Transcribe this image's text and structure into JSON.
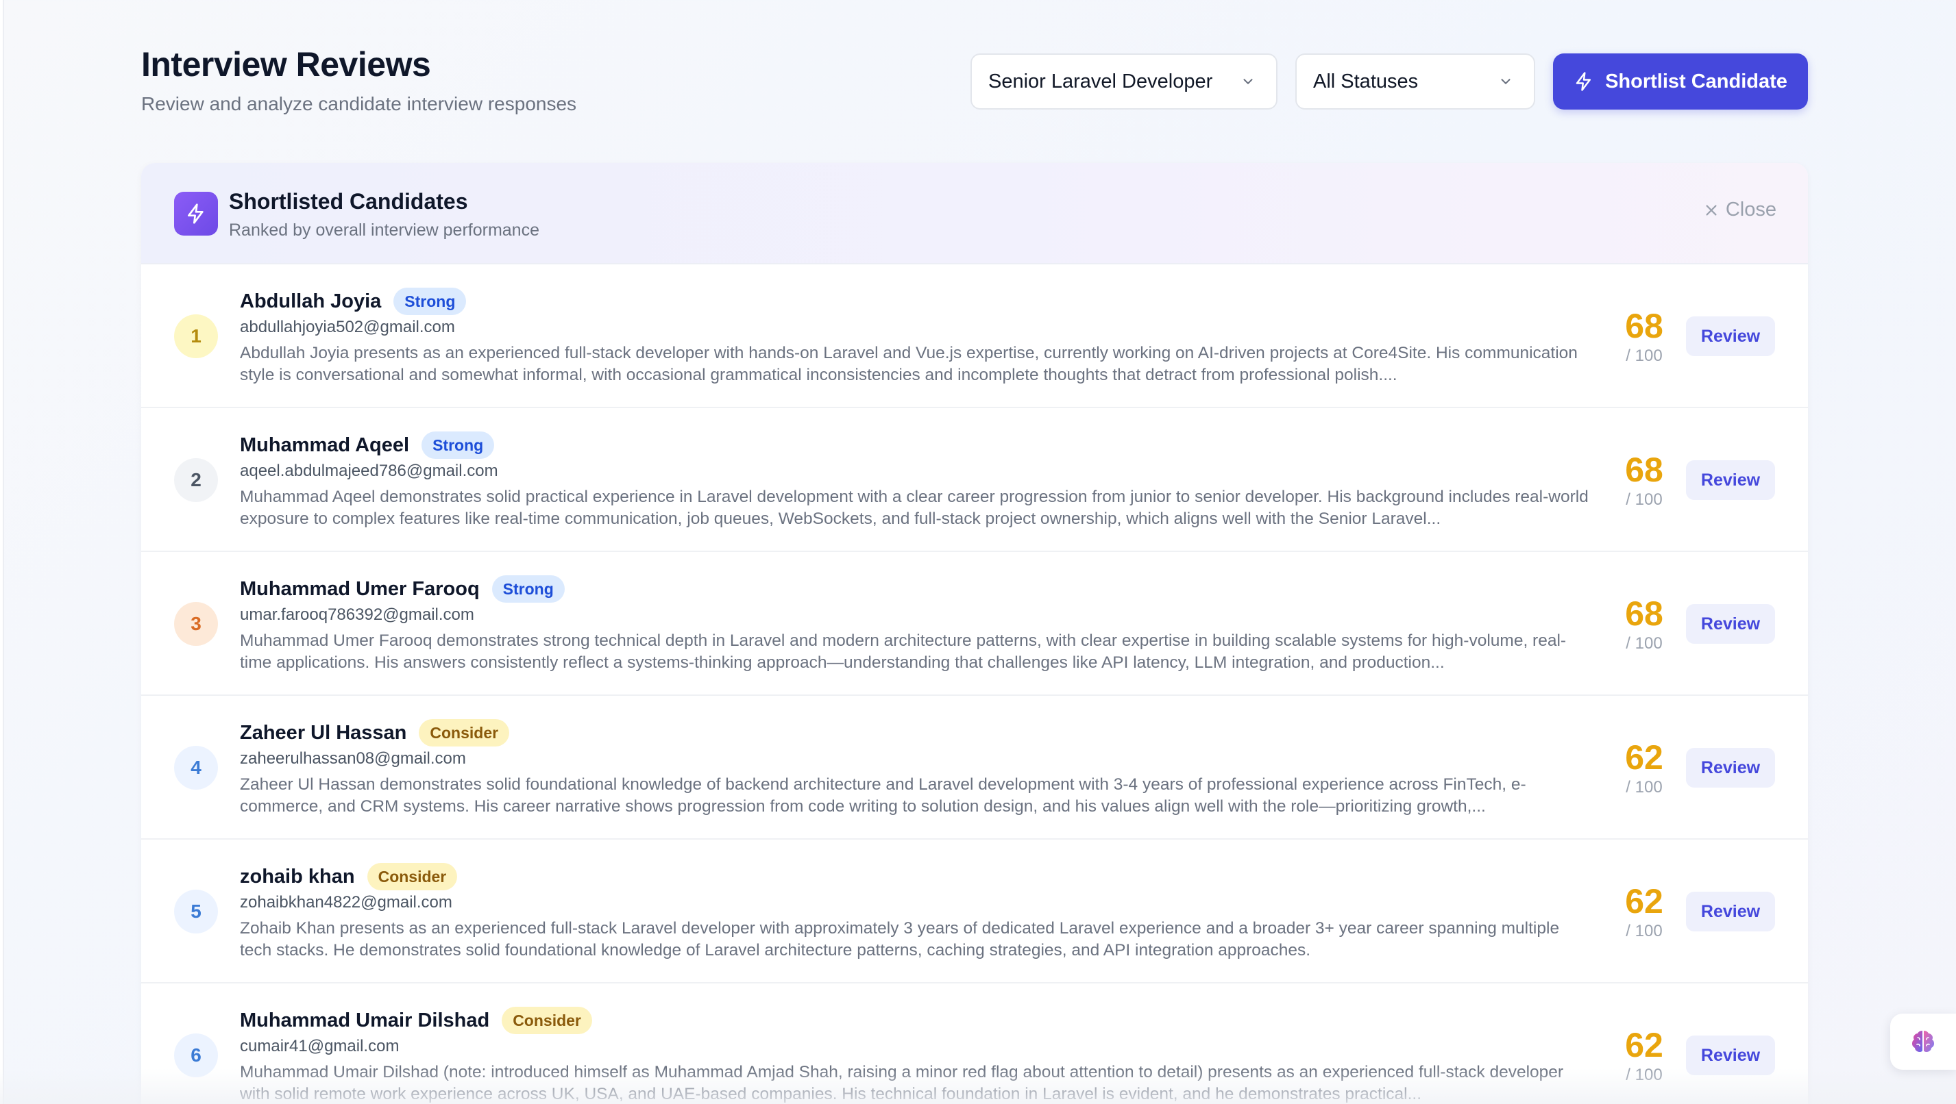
{
  "header": {
    "title": "Interview Reviews",
    "subtitle": "Review and analyze candidate interview responses",
    "job_filter": "Senior Laravel Developer",
    "status_filter": "All Statuses",
    "shortlist_label": "Shortlist Candidate"
  },
  "panel": {
    "title": "Shortlisted Candidates",
    "subtitle": "Ranked by overall interview performance",
    "close_label": "Close"
  },
  "candidates": [
    {
      "rank": "1",
      "name": "Abdullah Joyia",
      "badge": "Strong",
      "email": "abdullahjoyia502@gmail.com",
      "summary": "Abdullah Joyia presents as an experienced full-stack developer with hands-on Laravel and Vue.js expertise, currently working on AI-driven projects at Core4Site. His communication style is conversational and somewhat informal, with occasional grammatical inconsistencies and incomplete thoughts that detract from professional polish....",
      "score": "68",
      "score_max": "/ 100",
      "review_label": "Review"
    },
    {
      "rank": "2",
      "name": "Muhammad Aqeel",
      "badge": "Strong",
      "email": "aqeel.abdulmajeed786@gmail.com",
      "summary": "Muhammad Aqeel demonstrates solid practical experience in Laravel development with a clear career progression from junior to senior developer. His background includes real-world exposure to complex features like real-time communication, job queues, WebSockets, and full-stack project ownership, which aligns well with the Senior Laravel...",
      "score": "68",
      "score_max": "/ 100",
      "review_label": "Review"
    },
    {
      "rank": "3",
      "name": "Muhammad Umer Farooq",
      "badge": "Strong",
      "email": "umar.farooq786392@gmail.com",
      "summary": "Muhammad Umer Farooq demonstrates strong technical depth in Laravel and modern architecture patterns, with clear expertise in building scalable systems for high-volume, real-time applications. His answers consistently reflect a systems-thinking approach—understanding that challenges like API latency, LLM integration, and production...",
      "score": "68",
      "score_max": "/ 100",
      "review_label": "Review"
    },
    {
      "rank": "4",
      "name": "Zaheer Ul Hassan",
      "badge": "Consider",
      "email": "zaheerulhassan08@gmail.com",
      "summary": "Zaheer Ul Hassan demonstrates solid foundational knowledge of backend architecture and Laravel development with 3-4 years of professional experience across FinTech, e-commerce, and CRM systems. His career narrative shows progression from code writing to solution design, and his values align well with the role—prioritizing growth,...",
      "score": "62",
      "score_max": "/ 100",
      "review_label": "Review"
    },
    {
      "rank": "5",
      "name": "zohaib khan",
      "badge": "Consider",
      "email": "zohaibkhan4822@gmail.com",
      "summary": "Zohaib Khan presents as an experienced full-stack Laravel developer with approximately 3 years of dedicated Laravel experience and a broader 3+ year career spanning multiple tech stacks. He demonstrates solid foundational knowledge of Laravel architecture patterns, caching strategies, and API integration approaches.",
      "score": "62",
      "score_max": "/ 100",
      "review_label": "Review"
    },
    {
      "rank": "6",
      "name": "Muhammad Umair Dilshad",
      "badge": "Consider",
      "email": "cumair41@gmail.com",
      "summary": "Muhammad Umair Dilshad (note: introduced himself as Muhammad Amjad Shah, raising a minor red flag about attention to detail) presents as an experienced full-stack developer with solid remote work experience across UK, USA, and UAE-based companies. His technical foundation in Laravel is evident, and he demonstrates practical...",
      "score": "62",
      "score_max": "/ 100",
      "review_label": "Review"
    }
  ],
  "icons": {
    "shortlist": "bolt-icon",
    "panel": "bolt-icon",
    "close": "close-icon",
    "dropdown": "chevron-down-icon",
    "assistant": "brain-icon"
  },
  "colors": {
    "primary": "#4548dc",
    "score": "#e9a50d",
    "strong_badge": "#1d4ed8",
    "consider_badge": "#8a5a0b"
  }
}
